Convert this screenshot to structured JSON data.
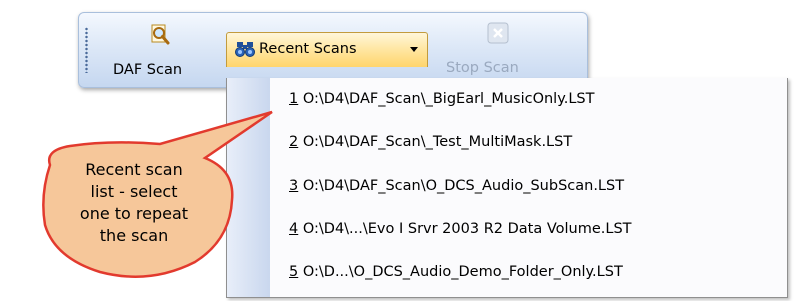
{
  "toolbar": {
    "daf_scan_label": "DAF Scan",
    "recent_scans_label": "Recent Scans",
    "stop_scan_label": "Stop Scan"
  },
  "recent_menu": {
    "items": [
      {
        "num": "1",
        "path": " O:\\D4\\DAF_Scan\\_BigEarl_MusicOnly.LST"
      },
      {
        "num": "2",
        "path": " O:\\D4\\DAF_Scan\\_Test_MultiMask.LST"
      },
      {
        "num": "3",
        "path": " O:\\D4\\DAF_Scan\\O_DCS_Audio_SubScan.LST"
      },
      {
        "num": "4",
        "path": " O:\\D4\\...\\Evo I Srvr 2003 R2 Data Volume.LST"
      },
      {
        "num": "5",
        "path": " O:\\D...\\O_DCS_Audio_Demo_Folder_Only.LST"
      }
    ]
  },
  "callout": {
    "lines": [
      "Recent scan",
      "list - select",
      "one to repeat",
      "the scan"
    ]
  },
  "colors": {
    "toolbar_top": "#f4f8fe",
    "toolbar_bottom": "#c5d7f0",
    "hover_button": "#ffd56c",
    "callout_fill": "#f6c79a",
    "callout_stroke": "#e23a2e",
    "menu_gutter": "#c9d7ee"
  },
  "icons": {
    "daf_scan": "magnifier-document-icon",
    "recent_scans": "binoculars-icon",
    "stop_scan": "close-icon"
  }
}
